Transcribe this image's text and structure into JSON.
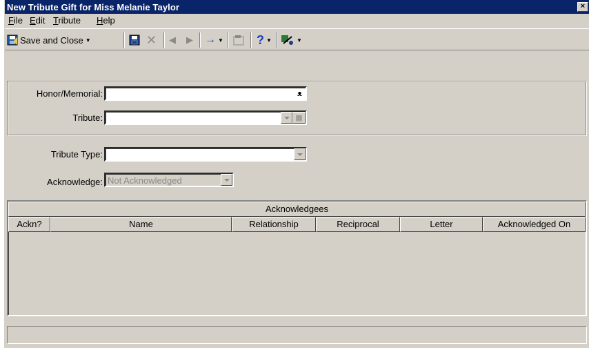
{
  "window": {
    "title": "New Tribute Gift for Miss Melanie Taylor",
    "close_label": "×"
  },
  "menu": [
    "File",
    "Edit",
    "Tribute",
    "Help"
  ],
  "toolbar": {
    "save_close_label": "Save and Close"
  },
  "form": {
    "honor_memorial_label": "Honor/Memorial:",
    "honor_memorial_value": "",
    "tribute_label": "Tribute:",
    "tribute_value": "",
    "tribute_type_label": "Tribute Type:",
    "tribute_type_value": "",
    "acknowledge_label": "Acknowledge:",
    "acknowledge_value": "Not Acknowledged"
  },
  "grid": {
    "title": "Acknowledgees",
    "columns": [
      "Ackn?",
      "Name",
      "Relationship",
      "Reciprocal",
      "Letter",
      "Acknowledged On"
    ],
    "rows": []
  },
  "status": {
    "text": ""
  }
}
